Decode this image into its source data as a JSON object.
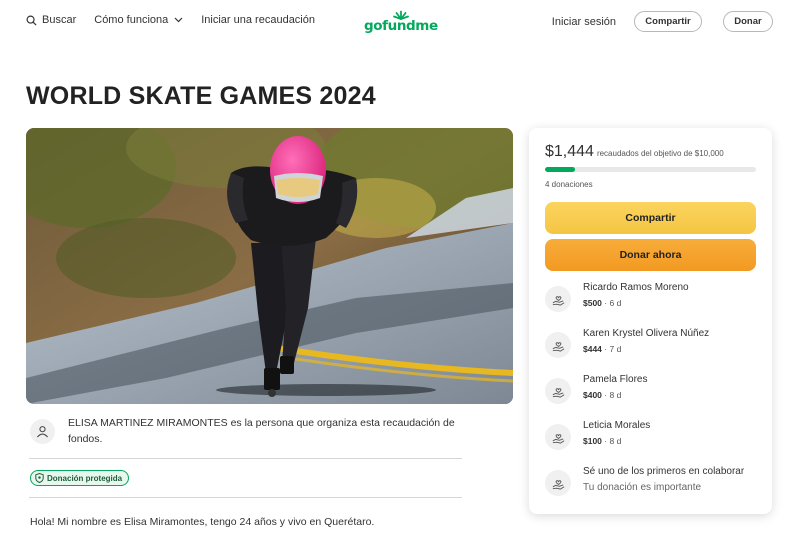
{
  "header": {
    "search_label": "Buscar",
    "how_it_works_label": "Cómo funciona",
    "start_label": "Iniciar una recaudación",
    "logo_text": "gofundme",
    "login_label": "Iniciar sesión",
    "share_label": "Compartir",
    "donate_label": "Donar"
  },
  "campaign": {
    "title": "WORLD SKATE GAMES 2024",
    "organizer_text": "ELISA MARTINEZ MIRAMONTES es la persona que organiza esta recaudación de fondos.",
    "protected_badge": "Donación protegida",
    "story_start": "Hola! Mi nombre es Elisa Miramontes, tengo 24 años y vivo en Querétaro."
  },
  "donation_card": {
    "raised_amount": "$1,444",
    "raised_goal_text": "recaudados del objetivo de $10,000",
    "progress_fraction": 0.144,
    "donation_count": "4 donaciones",
    "share_button": "Compartir",
    "donate_button": "Donar ahora",
    "donors": [
      {
        "name": "Ricardo Ramos Moreno",
        "amount": "$500",
        "time": "6 d"
      },
      {
        "name": "Karen Krystel Olivera Núñez",
        "amount": "$444",
        "time": "7 d"
      },
      {
        "name": "Pamela Flores",
        "amount": "$400",
        "time": "8 d"
      },
      {
        "name": "Leticia Morales",
        "amount": "$100",
        "time": "8 d"
      }
    ],
    "first_cta": {
      "title": "Sé uno de los primeros en colaborar",
      "subtitle": "Tu donación es importante"
    }
  },
  "colors": {
    "brand_green": "#02a95c",
    "share_yellow": "#f5c543",
    "donate_orange": "#f29a22",
    "helmet_pink": "#ee2f88"
  },
  "icons": {
    "search": "search-icon",
    "chevron": "chevron-down-icon",
    "logo_sprout": "sprout-icon",
    "organizer": "user-icon",
    "shield": "shield-icon",
    "donor": "heart-hand-icon"
  }
}
